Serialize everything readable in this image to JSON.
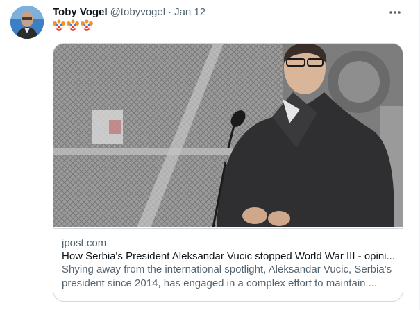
{
  "tweet": {
    "author_name": "Toby Vogel",
    "author_handle": "@tobyvogel",
    "separator": "·",
    "date": "Jan 12",
    "emojis": [
      "clown-face",
      "clown-face",
      "clown-face"
    ]
  },
  "card": {
    "domain": "jpost.com",
    "title": "How Serbia's President Aleksandar Vucic stopped World War III - opini...",
    "description": "Shying away from the international spotlight, Aleksandar Vucic, Serbia's president since 2014, has engaged in a complex effort to maintain ..."
  },
  "icons": {
    "more": "more-horizontal-icon"
  },
  "colors": {
    "text_primary": "#0f1419",
    "text_secondary": "#536471",
    "border": "#cfd9de"
  }
}
